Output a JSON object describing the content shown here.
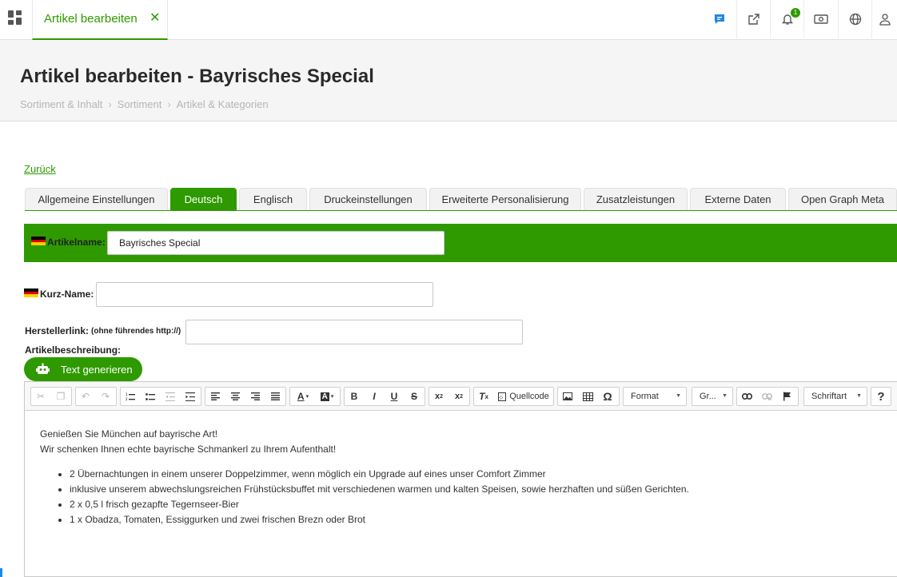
{
  "topbar": {
    "tab_label": "Artikel bearbeiten",
    "close_glyph": "✕",
    "notification_count": "1",
    "icons": [
      "apps-icon",
      "chat-icon",
      "external-link-icon",
      "bell-icon",
      "cash-icon",
      "globe-icon",
      "user-icon"
    ]
  },
  "header": {
    "title": "Artikel bearbeiten - Bayrisches Special",
    "breadcrumb": [
      "Sortiment & Inhalt",
      "Sortiment",
      "Artikel & Kategorien"
    ],
    "breadcrumb_sep": "›"
  },
  "back_link": "Zurück",
  "tabs": [
    {
      "label": "Allgemeine Einstellungen",
      "active": false
    },
    {
      "label": "Deutsch",
      "active": true
    },
    {
      "label": "Englisch",
      "active": false
    },
    {
      "label": "Druckeinstellungen",
      "active": false
    },
    {
      "label": "Erweiterte Personalisierung",
      "active": false
    },
    {
      "label": "Zusatzleistungen",
      "active": false
    },
    {
      "label": "Externe Daten",
      "active": false
    },
    {
      "label": "Open Graph Meta",
      "active": false
    }
  ],
  "form": {
    "article_name_label": "Artikelname:",
    "article_name_value": "Bayrisches Special",
    "short_name_label": "Kurz-Name:",
    "short_name_value": "",
    "manufacturer_label": "Herstellerlink:",
    "manufacturer_hint": "(ohne führendes http://)",
    "manufacturer_value": "",
    "description_label": "Artikelbeschreibung:",
    "generate_button": "Text generieren"
  },
  "editor": {
    "toolbar": {
      "source_label": "Quellcode",
      "format_label": "Format",
      "size_label": "Gr...",
      "font_label": "Schriftart",
      "help_label": "?"
    },
    "content": {
      "line1": "Genießen Sie München auf bayrische Art!",
      "line2": "Wir schenken Ihnen echte bayrische Schmankerl zu Ihrem Aufenthalt!",
      "items": [
        "2 Übernachtungen in einem unserer Doppelzimmer, wenn möglich ein Upgrade auf eines unser Comfort Zimmer",
        "inklusive unserem abwechslungsreichen Frühstücksbuffet mit verschiedenen warmen und kalten Speisen, sowie herzhaften und süßen Gerichten.",
        "2 x 0,5 l frisch gezapfte Tegernseer-Bier",
        "1 x Obadza, Tomaten, Essiggurken und zwei frischen Brezn oder Brot"
      ]
    }
  },
  "colors": {
    "accent": "#2e9a00",
    "header_bg": "#f5f5f5"
  }
}
